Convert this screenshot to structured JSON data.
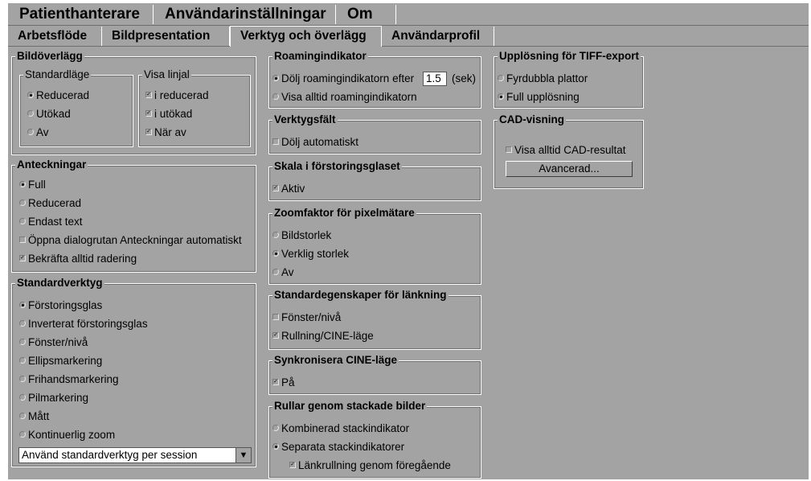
{
  "main_tabs": [
    {
      "label": "Patienthanterare"
    },
    {
      "label": "Användarinställningar"
    },
    {
      "label": "Om"
    }
  ],
  "sub_tabs": [
    {
      "label": "Arbetsflöde"
    },
    {
      "label": "Bildpresentation"
    },
    {
      "label": "Verktyg och överlägg",
      "active": true
    },
    {
      "label": "Användarprofil"
    }
  ],
  "bildoverlagg": {
    "title": "Bildöverlägg",
    "standardlage": {
      "title": "Standardläge",
      "options": [
        "Reducerad",
        "Utökad",
        "Av"
      ],
      "selected": "Reducerad"
    },
    "visa_linjal": {
      "title": "Visa linjal",
      "options": [
        {
          "label": "i reducerad",
          "checked": true
        },
        {
          "label": "i utökad",
          "checked": true
        },
        {
          "label": "När av",
          "checked": true
        }
      ]
    }
  },
  "anteckningar": {
    "title": "Anteckningar",
    "options": [
      "Full",
      "Reducerad",
      "Endast text"
    ],
    "selected": "Full",
    "checks": [
      {
        "label": "Öppna dialogrutan Anteckningar automatiskt",
        "checked": false
      },
      {
        "label": "Bekräfta alltid radering",
        "checked": true
      }
    ]
  },
  "standardverktyg": {
    "title": "Standardverktyg",
    "options": [
      "Förstoringsglas",
      "Inverterat förstoringsglas",
      "Fönster/nivå",
      "Ellipsmarkering",
      "Frihandsmarkering",
      "Pilmarkering",
      "Mått",
      "Kontinuerlig zoom"
    ],
    "selected": "Förstoringsglas",
    "dropdown": "Använd standardverktyg per session"
  },
  "roaming": {
    "title": "Roamingindikator",
    "hide_after_label": "Dölj roamingindikatorn efter",
    "value": "1.5",
    "unit": "(sek)",
    "always_label": "Visa alltid roamingindikatorn",
    "selected": "hide"
  },
  "verktygsfalt": {
    "title": "Verktygsfält",
    "check_label": "Dölj automatiskt",
    "checked": false
  },
  "skala": {
    "title": "Skala i förstoringsglaset",
    "check_label": "Aktiv",
    "checked": true
  },
  "zoom": {
    "title": "Zoomfaktor för pixelmätare",
    "options": [
      "Bildstorlek",
      "Verklig storlek",
      "Av"
    ],
    "selected": "Verklig storlek"
  },
  "lankning": {
    "title": "Standardegenskaper för länkning",
    "checks": [
      {
        "label": "Fönster/nivå",
        "checked": false
      },
      {
        "label": "Rullning/CINE-läge",
        "checked": true
      }
    ]
  },
  "synk": {
    "title": "Synkronisera CINE-läge",
    "check_label": "På",
    "checked": true
  },
  "rullar": {
    "title": "Rullar genom stackade bilder",
    "options": [
      "Kombinerad stackindikator",
      "Separata stackindikatorer"
    ],
    "selected": "Separata stackindikatorer",
    "sub_check": {
      "label": "Länkrullning genom föregående",
      "checked": true
    }
  },
  "tiff": {
    "title": "Upplösning för TIFF-export",
    "options": [
      "Fyrdubbla plattor",
      "Full upplösning"
    ],
    "selected": "Full upplösning"
  },
  "cad": {
    "title": "CAD-visning",
    "check_label": "Visa alltid CAD-resultat",
    "checked": false,
    "button": "Avancerad..."
  },
  "colors": {
    "panel": "#a3a3a3",
    "highlight": "#ffffff",
    "shadow": "#6e6e6e"
  }
}
